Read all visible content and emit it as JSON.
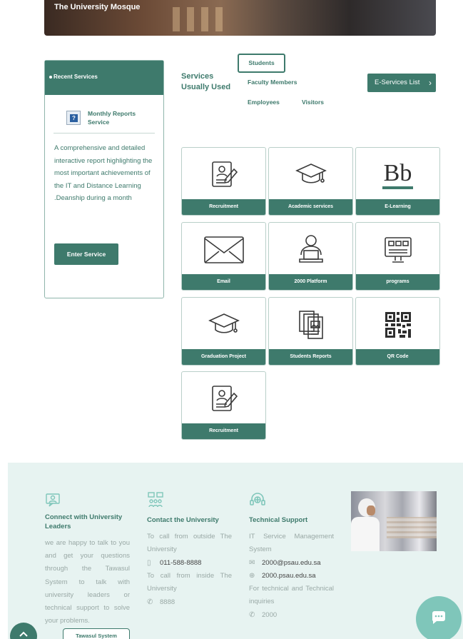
{
  "banner": {
    "title": "The University Mosque"
  },
  "recent": {
    "header": "Recent Services",
    "item_title": "Monthly Reports Service",
    "item_icon": "question-report-icon",
    "description": "A comprehensive and detailed interactive report highlighting the most important achievements of the IT and Distance Learning .Deanship during a month",
    "enter_label": "Enter Service"
  },
  "services": {
    "heading": "Services Usually Used",
    "tabs": {
      "students": "Students",
      "faculty": "Faculty Members",
      "employees": "Employees",
      "visitors": "Visitors"
    },
    "eservices_label": "E-Services List"
  },
  "tiles": [
    {
      "label": "Recruitment",
      "icon": "cv-document-icon"
    },
    {
      "label": "Academic services",
      "icon": "graduation-cap-icon"
    },
    {
      "label": "E-Learning",
      "icon": "blackboard-bb-icon"
    },
    {
      "label": "Email",
      "icon": "envelope-icon"
    },
    {
      "label": "2000 Platform",
      "icon": "person-laptop-icon"
    },
    {
      "label": "programs",
      "icon": "monitor-apps-icon"
    },
    {
      "label": "Graduation Project",
      "icon": "graduation-cap-icon"
    },
    {
      "label": "Students Reports",
      "icon": "documents-stack-icon"
    },
    {
      "label": "QR Code",
      "icon": "qr-code-icon"
    },
    {
      "label": "Recruitment",
      "icon": "cv-document-icon"
    }
  ],
  "bb_text": "Bb",
  "footer": {
    "leaders": {
      "title": "Connect with University Leaders",
      "text": "we are happy to talk to you and get your questions through the Tawasul System to talk with university leaders or technical support to solve your problems.",
      "button": "Tawasul System"
    },
    "contact": {
      "title": "Contact the University",
      "outside_text": "To call from outside The University",
      "outside_number": "011-588-8888",
      "inside_text": "To call from inside The University",
      "inside_number": "8888"
    },
    "support": {
      "title": "Technical Support",
      "system_text": "IT Service Management System",
      "email": "2000@psau.edu.sa",
      "website": "2000.psau.edu.sa",
      "inquiries_text": "For technical and Technical inquiries",
      "number": "2000"
    }
  },
  "colors": {
    "primary": "#3e7a6c",
    "footer_bg": "#e7f3f1",
    "chat": "#7fc6ba"
  }
}
